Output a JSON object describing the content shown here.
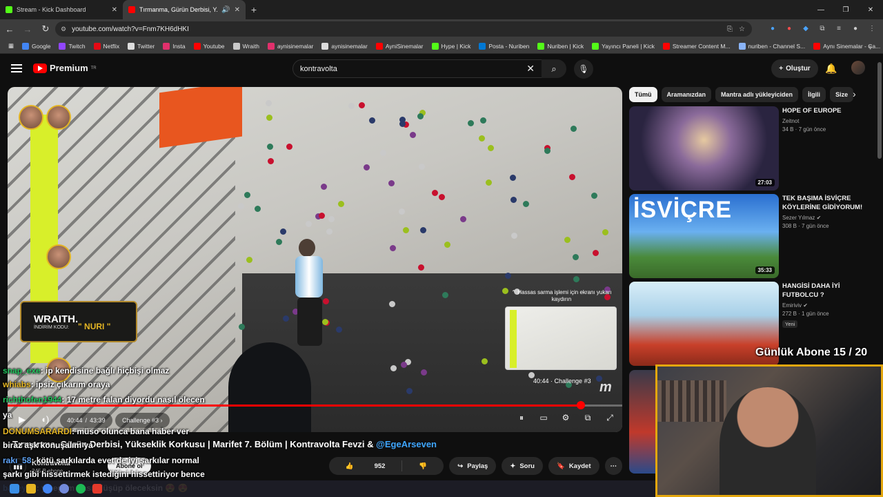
{
  "browser": {
    "tabs": [
      {
        "title": "Stream - Kick Dashboard",
        "color": "#53fc18"
      },
      {
        "title": "Tırmanma, Gürün Derbisi, Y...",
        "color": "#ff0000"
      }
    ],
    "url": "youtube.com/watch?v=Fnm7KH6dHKI",
    "bookmarks": [
      {
        "label": "Google",
        "color": "#4285f4"
      },
      {
        "label": "Twitch",
        "color": "#9146ff"
      },
      {
        "label": "Netflix",
        "color": "#e50914"
      },
      {
        "label": "Twitter",
        "color": "#dddddd"
      },
      {
        "label": "Insta",
        "color": "#e1306c"
      },
      {
        "label": "Youtube",
        "color": "#ff0000"
      },
      {
        "label": "Wraith",
        "color": "#c9c9c9"
      },
      {
        "label": "aynisinemalar",
        "color": "#e1306c"
      },
      {
        "label": "aynisinemalar",
        "color": "#dddddd"
      },
      {
        "label": "AyniSinemalar",
        "color": "#ff0000"
      },
      {
        "label": "Hype | Kick",
        "color": "#53fc18"
      },
      {
        "label": "Posta - Nuriben",
        "color": "#0078d4"
      },
      {
        "label": "Nuriben | Kick",
        "color": "#53fc18"
      },
      {
        "label": "Yayıncı Paneli | Kick",
        "color": "#53fc18"
      },
      {
        "label": "Streamer Content M...",
        "color": "#ff0000"
      },
      {
        "label": "nuriben - Channel S...",
        "color": "#8ab4f8"
      },
      {
        "label": "Aynı Sinemalar - Ça...",
        "color": "#ff0000"
      }
    ]
  },
  "youtube": {
    "logo": "Premium",
    "logo_sup": "TR",
    "search_value": "kontravolta",
    "create_label": "Oluştur"
  },
  "player": {
    "current_time": "40:44",
    "duration": "43:39",
    "chapter": "Challenge #3",
    "preview_time": "40:44",
    "preview_chapter": "Challenge #3",
    "hint": "Hassas sarma işlemi için ekranı yukarı kaydırın",
    "progress_percent": 93.3,
    "overlay_brand": "WRAITH.",
    "overlay_code_label": "İNDİRİM KODU:",
    "overlay_code": "\" NURI \""
  },
  "video": {
    "title": "Tırmanma, Gürün Derbisi, Yükseklik Korkusu | Marifet 7. Bölüm | Kontravolta Fevzi & ",
    "mention": "@EgeArseven",
    "channel_name": "Kontravolta",
    "channel_subs": "245 B abone",
    "subscribe": "Abone ol",
    "likes": "952",
    "share": "Paylaş",
    "ask": "Soru",
    "save": "Kaydet"
  },
  "chips": [
    "Tümü",
    "Aramanızdan",
    "Mantra adlı yükleyiciden",
    "İlgili",
    "Size"
  ],
  "recommendations": [
    {
      "title": "HOPE OF EUROPE",
      "channel": "Zeitnot",
      "meta": "34 B · 7 gün önce",
      "duration": "27:03",
      "verified": false,
      "badge": ""
    },
    {
      "title": "TEK BAŞIMA İSVİÇRE KÖYLERİNE GİDİYORUM!",
      "channel": "Sezer Yılmaz",
      "meta": "308 B · 7 gün önce",
      "duration": "35:33",
      "verified": true,
      "badge": ""
    },
    {
      "title": "HANGİSİ DAHA İYİ FUTBOLCU ?",
      "channel": "Emiriviv",
      "meta": "272 B · 1 gün önce",
      "duration": "",
      "verified": true,
      "badge": "Yeni"
    }
  ],
  "stream_overlay": {
    "sub_goal": "Günlük Abone 15 / 20",
    "chat": [
      {
        "user": "snap_exe",
        "user_color": "#22c55e",
        "msg": ": ip kendisine bağlı hiçbişi olmaz"
      },
      {
        "user": "whiabs",
        "user_color": "#e4b524",
        "msg": ": ipsiz çıkarım oraya"
      },
      {
        "user": "richthofen1944",
        "user_color": "#22c55e",
        "msg": ": 17 metre falan diyordu nasıl ölecen"
      },
      {
        "user": "",
        "user_color": "#ffffff",
        "msg": "ya"
      },
      {
        "user": "DONUMSARARDI",
        "user_color": "#e4b524",
        "msg": ": müso olunca bana haber ver"
      },
      {
        "user": "",
        "user_color": "#ffffff",
        "msg": "biraz aşk konuşalım ya"
      },
      {
        "user": "rakı_58",
        "user_color": "#60a5fa",
        "msg": ": kötü şarkılarda evet de iyi şarkılar normal"
      },
      {
        "user": "",
        "user_color": "#ffffff",
        "msg": "şarkı gibi hissettirmek istediğini hissettiriyor bence"
      },
      {
        "user": "baileyob",
        "user_color": "#60a5fa",
        "msg": ": ya egem nasıl düşüp öleceksin 😍 😍"
      }
    ]
  }
}
